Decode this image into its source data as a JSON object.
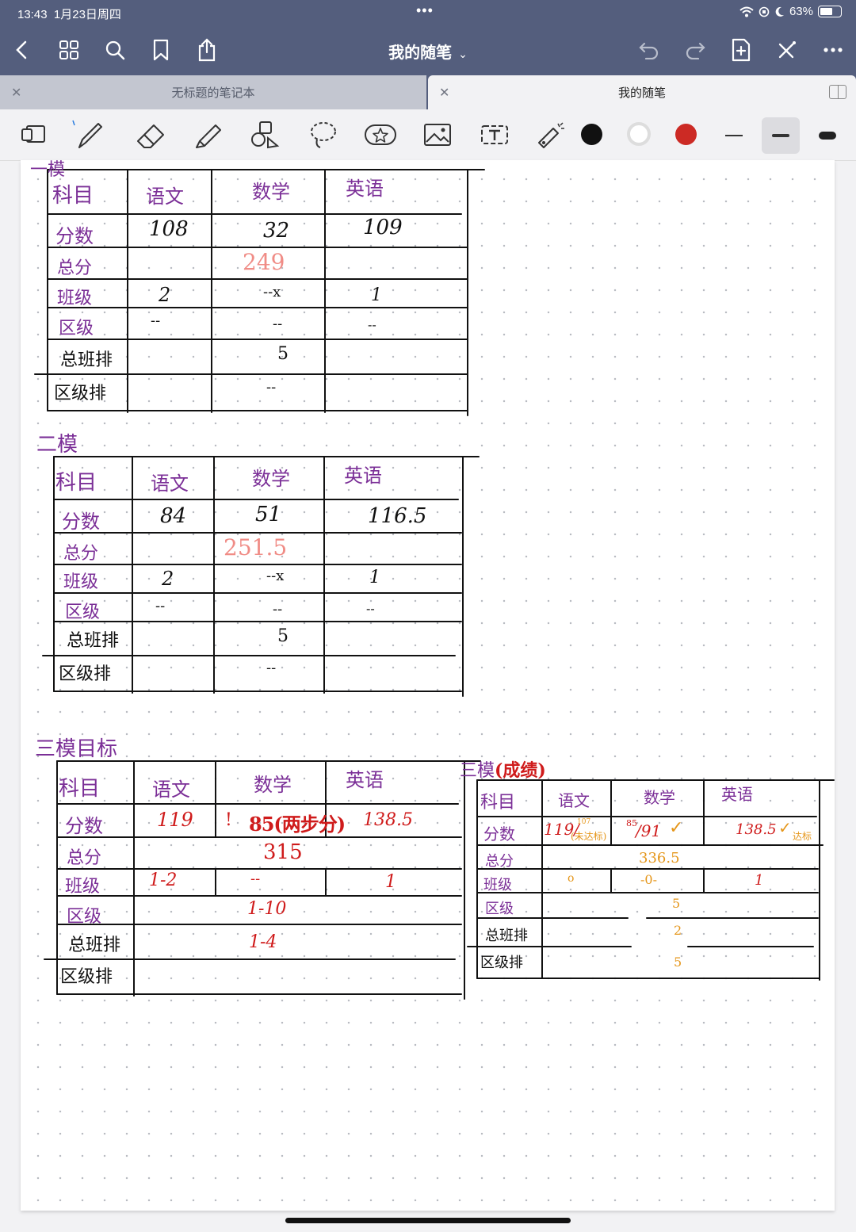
{
  "status": {
    "time": "13:43",
    "date": "1月23日周四",
    "battery": "63%",
    "battery_level": 0.63
  },
  "nav": {
    "title": "我的随笔"
  },
  "tabs": [
    {
      "label": "无标题的笔记本",
      "active": false
    },
    {
      "label": "我的随笔",
      "active": true
    }
  ],
  "toolbar": {
    "tools": [
      "page-layout-icon",
      "pen-icon",
      "eraser-icon",
      "highlighter-icon",
      "shapes-icon",
      "lasso-icon",
      "sticker-icon",
      "image-icon",
      "text-icon",
      "laser-pointer-icon"
    ],
    "colors": [
      "#111111",
      "#ffffff",
      "#cc2a24"
    ]
  },
  "note": {
    "t1": {
      "heading": "一模",
      "col_subject": "科目",
      "col_chinese": "语文",
      "col_math": "数学",
      "col_english": "英语",
      "row_score": "分数",
      "score_chinese": "108",
      "score_math": "32",
      "score_english": "109",
      "row_total": "总分",
      "total": "249",
      "row_class": "班级",
      "class_chinese": "2",
      "class_math": "--x",
      "class_english": "1",
      "row_district": "区级",
      "district_chinese": "--",
      "district_math": "--",
      "district_english": "--",
      "row_total_class_rank": "总班排",
      "total_class_rank": "5",
      "row_district_rank": "区级排",
      "district_rank": "--"
    },
    "t2": {
      "heading": "二模",
      "col_subject": "科目",
      "col_chinese": "语文",
      "col_math": "数学",
      "col_english": "英语",
      "row_score": "分数",
      "score_chinese": "84",
      "score_math": "51",
      "score_english": "116.5",
      "row_total": "总分",
      "total": "251.5",
      "row_class": "班级",
      "class_chinese": "2",
      "class_math": "--x",
      "class_english": "1",
      "row_district": "区级",
      "district_chinese": "--",
      "district_math": "--",
      "district_english": "--",
      "row_total_class_rank": "总班排",
      "total_class_rank": "5",
      "row_district_rank": "区级排",
      "district_rank": "--"
    },
    "t3": {
      "heading": "三模目标",
      "col_subject": "科目",
      "col_chinese": "语文",
      "col_math": "数学",
      "col_english": "英语",
      "row_score": "分数",
      "score_chinese": "119",
      "score_math_mark": "!",
      "score_math": "85(两步分)",
      "score_english": "138.5",
      "row_total": "总分",
      "total": "315",
      "row_class": "班级",
      "class_chinese": "1-2",
      "class_math": "--",
      "class_english": "1",
      "row_district": "区级",
      "district": "1-10",
      "row_total_class_rank": "总班排",
      "total_class_rank": "1-4",
      "row_district_rank": "区级排"
    },
    "t4": {
      "heading": "三模",
      "heading_extra": "(成绩)",
      "col_subject": "科目",
      "col_chinese": "语文",
      "col_math": "数学",
      "col_english": "英语",
      "row_score": "分数",
      "score_chinese": "119/",
      "score_chinese_small": "107",
      "score_chinese_note": "(未达标)",
      "score_math_small": "85",
      "score_math": "/91",
      "score_math_check": "✓",
      "score_english": "138.5",
      "score_english_check": "✓",
      "score_english_note": "达标",
      "row_total": "总分",
      "total": "336.5",
      "row_class": "班级",
      "class_chinese": "o",
      "class_math": "-0-",
      "class_english": "1",
      "row_district": "区级",
      "district": "5",
      "row_total_class_rank": "总班排",
      "total_class_rank": "2",
      "row_district_rank": "区级排",
      "district_rank": "5"
    }
  }
}
